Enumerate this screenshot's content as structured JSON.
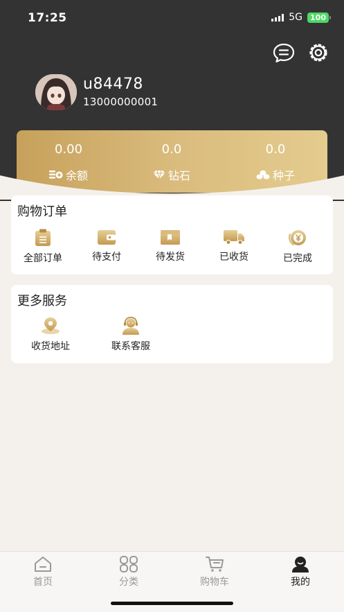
{
  "status": {
    "time": "17:25",
    "network": "5G",
    "battery": "100"
  },
  "header": {
    "message_icon": "message-icon",
    "settings_icon": "settings-gear-icon"
  },
  "profile": {
    "username": "u84478",
    "phone": "13000000001"
  },
  "assets": [
    {
      "value": "0.00",
      "label": "余额",
      "icon": "coin-icon"
    },
    {
      "value": "0.0",
      "label": "钻石",
      "icon": "diamond-icon"
    },
    {
      "value": "0.0",
      "label": "种子",
      "icon": "seed-icon"
    }
  ],
  "orders": {
    "title": "购物订单",
    "items": [
      {
        "label": "全部订单",
        "icon": "clipboard-icon"
      },
      {
        "label": "待支付",
        "icon": "wallet-icon"
      },
      {
        "label": "待发货",
        "icon": "box-icon"
      },
      {
        "label": "已收货",
        "icon": "truck-icon"
      },
      {
        "label": "已完成",
        "icon": "yen-coin-icon"
      }
    ]
  },
  "services": {
    "title": "更多服务",
    "items": [
      {
        "label": "收货地址",
        "icon": "location-pin-icon"
      },
      {
        "label": "联系客服",
        "icon": "headset-agent-icon"
      }
    ]
  },
  "tabbar": {
    "items": [
      {
        "label": "首页",
        "icon": "home-icon",
        "active": false
      },
      {
        "label": "分类",
        "icon": "category-grid-icon",
        "active": false
      },
      {
        "label": "购物车",
        "icon": "cart-icon",
        "active": false
      },
      {
        "label": "我的",
        "icon": "profile-icon",
        "active": true
      }
    ]
  },
  "colors": {
    "header_bg": "#333333",
    "gold_start": "#c7a15b",
    "gold_end": "#e4cc8e",
    "page_bg": "#f4f1ec"
  }
}
